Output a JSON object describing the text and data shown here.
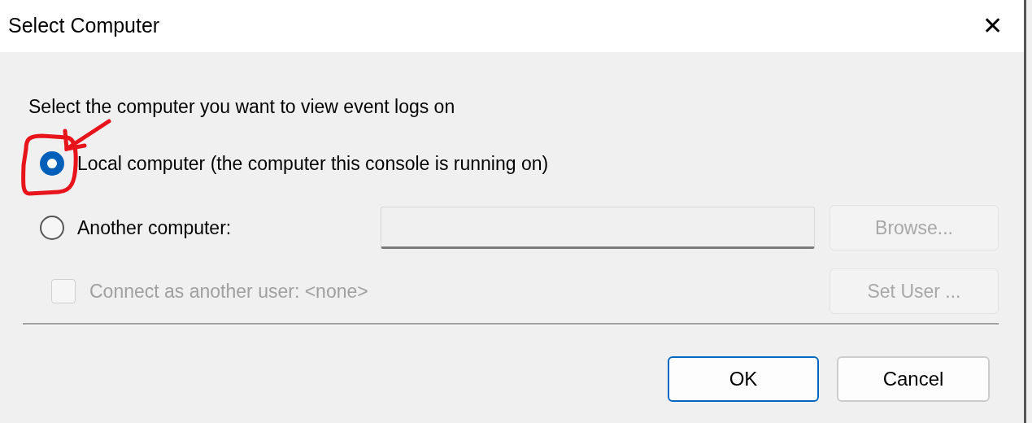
{
  "window": {
    "title": "Select Computer",
    "close": "✕"
  },
  "prompt": "Select the computer you want to view event logs on",
  "options": [
    {
      "kind": "radio",
      "label": "Local computer (the computer this console is running on)",
      "selected": true
    },
    {
      "kind": "radio",
      "label": "Another computer:",
      "selected": false
    }
  ],
  "computer_field": {
    "disabled": true
  },
  "browse_button": {
    "label": "Browse...",
    "disabled": true
  },
  "connect_checkbox": {
    "label": "Connect as another user: <none>",
    "checked": false,
    "disabled": true
  },
  "set_user_button": {
    "label": "Set User ...",
    "disabled": true
  },
  "buttons": [
    {
      "label": "OK",
      "default": true
    },
    {
      "label": "Cancel",
      "default": false
    }
  ]
}
